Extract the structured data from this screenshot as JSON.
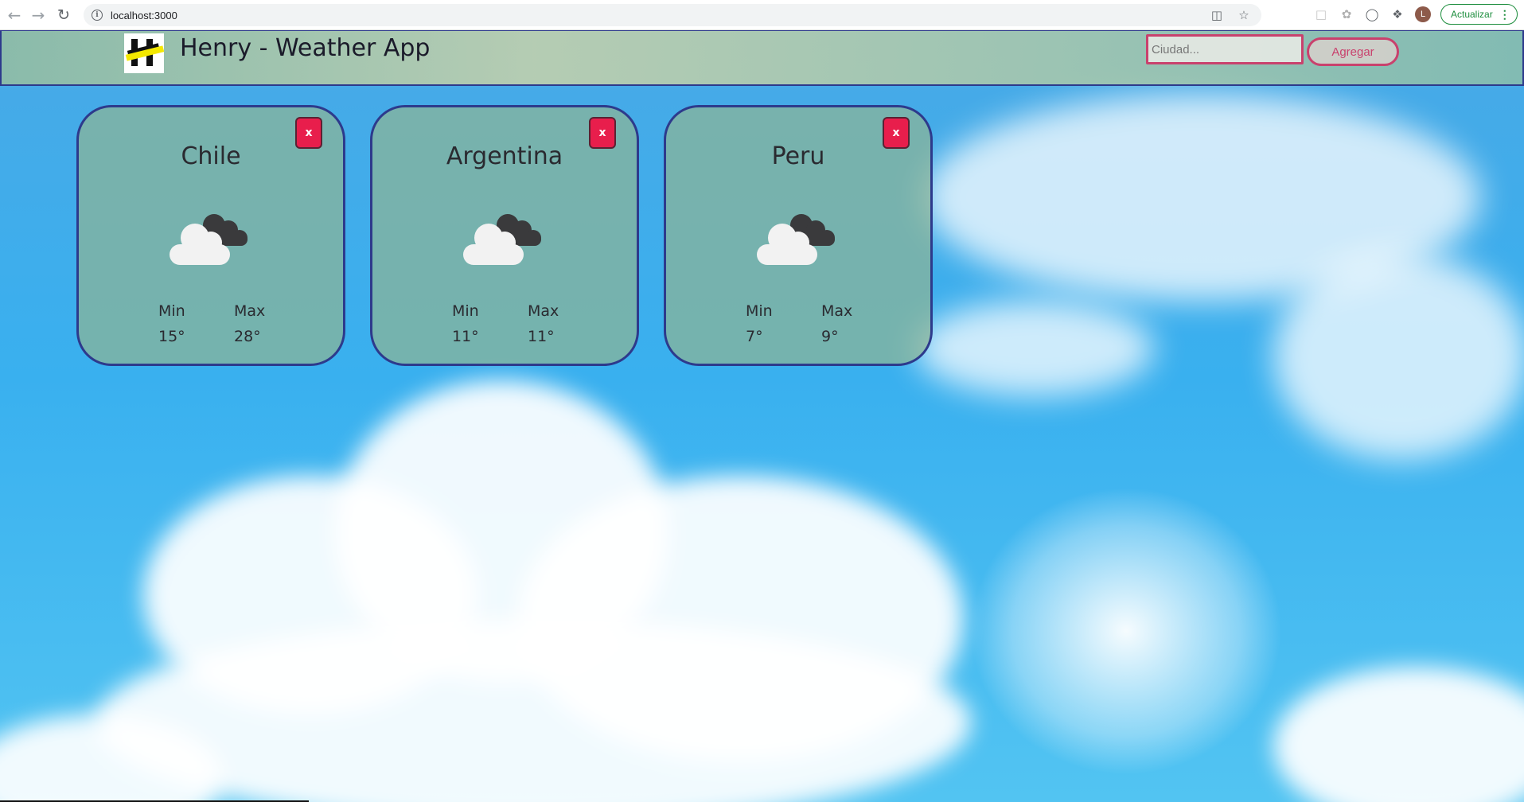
{
  "browser": {
    "url": "localhost:3000",
    "profile_initial": "L",
    "update_label": "Actualizar",
    "icons": [
      "back-icon",
      "forward-icon",
      "reload-icon",
      "info-icon",
      "translate-icon",
      "star-icon",
      "extension-icon",
      "extension-icon",
      "extension-icon",
      "puzzle-icon",
      "kebab-menu-icon"
    ]
  },
  "header": {
    "title": "Henry - Weather App",
    "search_placeholder": "Ciudad...",
    "add_label": "Agregar"
  },
  "cards": [
    {
      "city": "Chile",
      "min_label": "Min",
      "max_label": "Max",
      "min": "15°",
      "max": "28°",
      "close_label": "x",
      "icon": "cloudy-icon"
    },
    {
      "city": "Argentina",
      "min_label": "Min",
      "max_label": "Max",
      "min": "11°",
      "max": "11°",
      "close_label": "x",
      "icon": "cloudy-icon"
    },
    {
      "city": "Peru",
      "min_label": "Min",
      "max_label": "Max",
      "min": "7°",
      "max": "9°",
      "close_label": "x",
      "icon": "cloudy-icon"
    }
  ],
  "colors": {
    "accent": "#c9416d",
    "close_button": "#e81e4c",
    "card_border": "#2d3a8c",
    "update_green": "#1e8e3e"
  }
}
